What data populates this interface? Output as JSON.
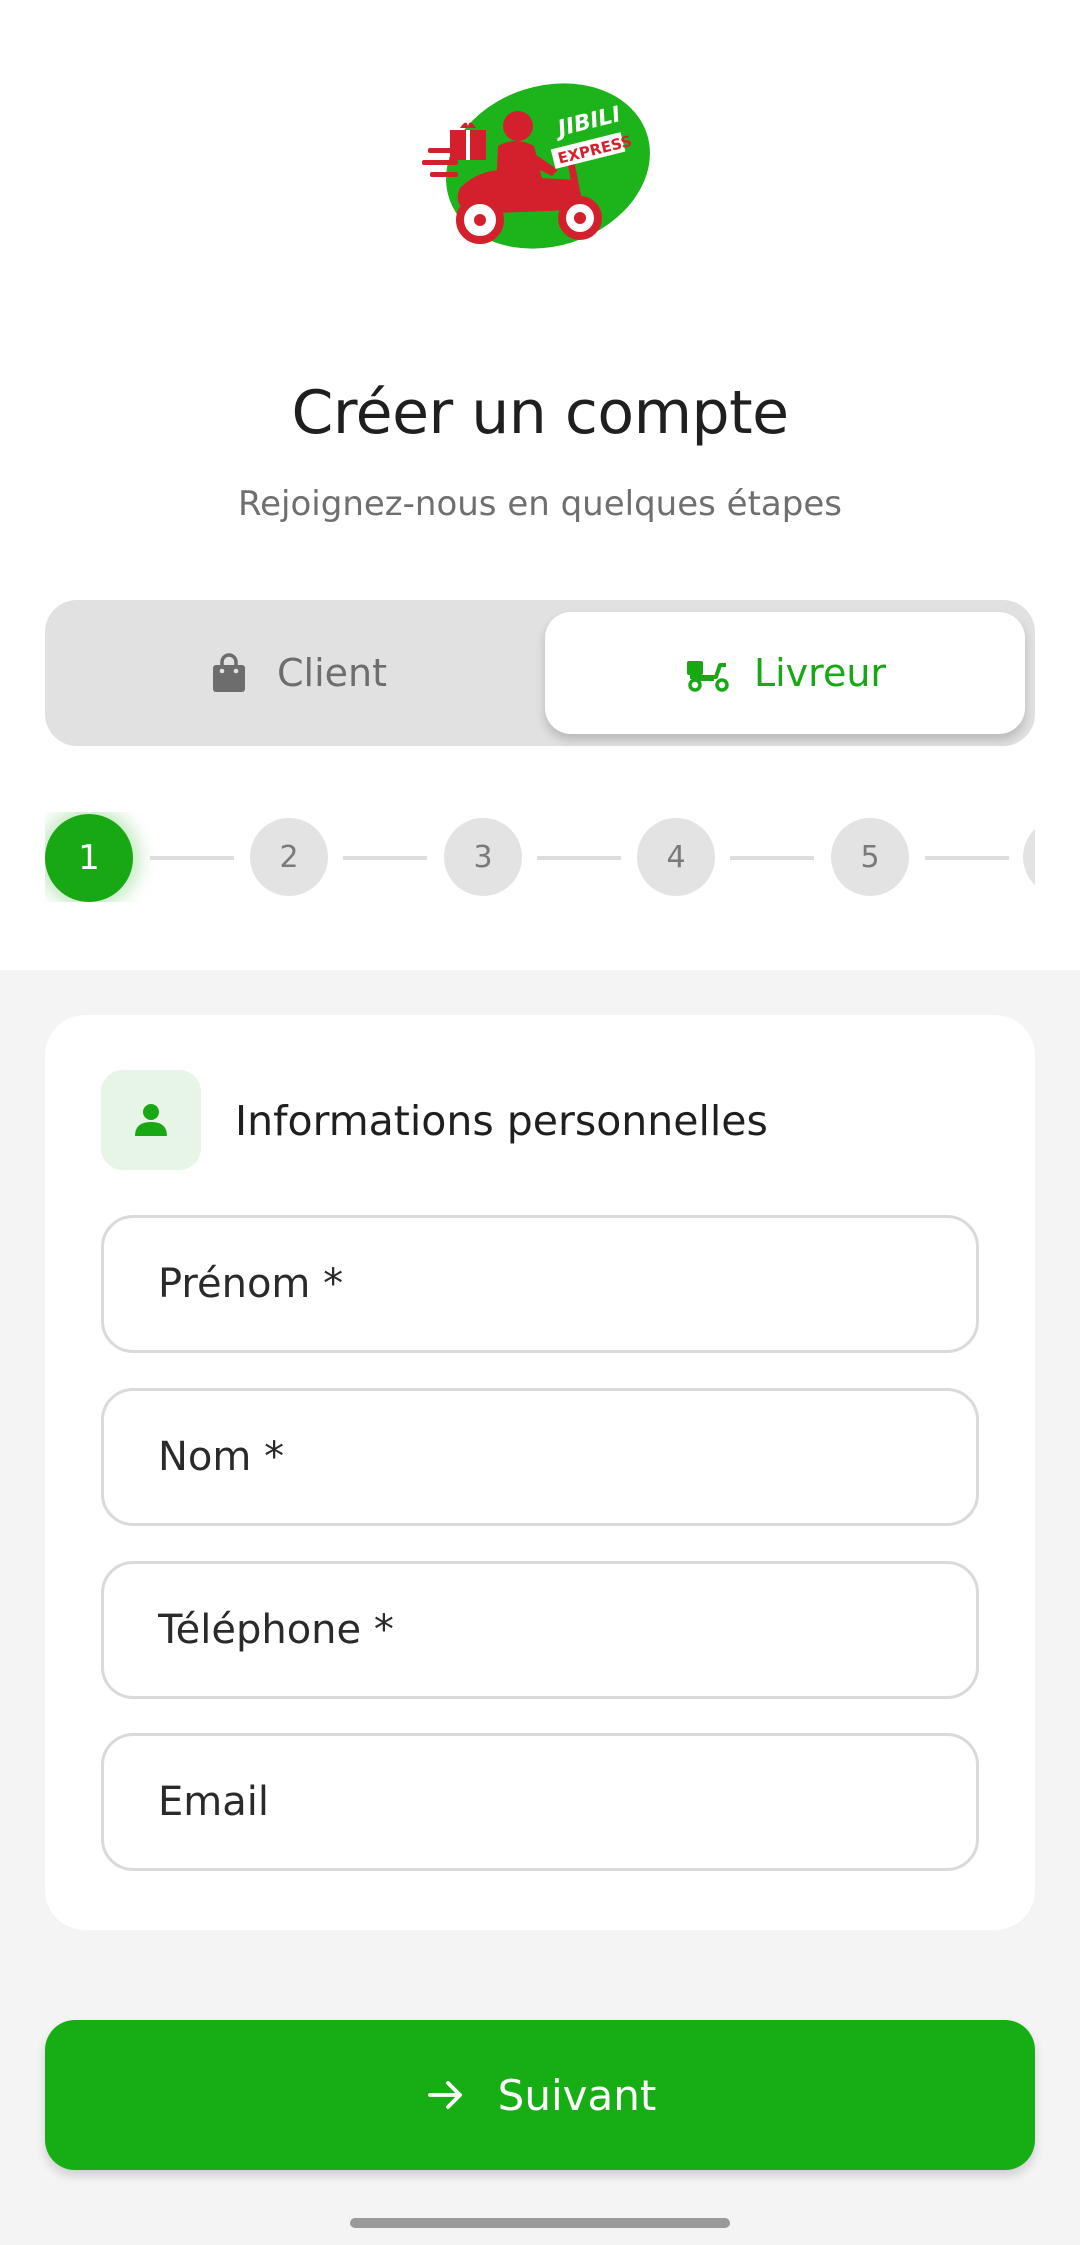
{
  "header": {
    "logo_text_top": "JIBILI",
    "logo_text_bottom": "EXPRESS",
    "title": "Créer un compte",
    "subtitle": "Rejoignez-nous en quelques étapes"
  },
  "account_type": {
    "options": [
      {
        "label": "Client",
        "icon": "shopping-bag-icon",
        "selected": false
      },
      {
        "label": "Livreur",
        "icon": "delivery-scooter-icon",
        "selected": true
      }
    ]
  },
  "stepper": {
    "current": 1,
    "steps": [
      "1",
      "2",
      "3",
      "4",
      "5"
    ]
  },
  "personal_info": {
    "icon": "person-icon",
    "title": "Informations personnelles",
    "fields": [
      {
        "placeholder": "Prénom *",
        "value": ""
      },
      {
        "placeholder": "Nom *",
        "value": ""
      },
      {
        "placeholder": "Téléphone *",
        "value": ""
      },
      {
        "placeholder": "Email",
        "value": ""
      }
    ]
  },
  "actions": {
    "next_label": "Suivant",
    "next_icon": "arrow-right-icon"
  },
  "colors": {
    "accent": "#17a814",
    "accent_light": "#e6f5e6",
    "logo_red": "#d4202c",
    "segment_bg": "#e1e1e1",
    "section_bg": "#f4f4f4"
  }
}
